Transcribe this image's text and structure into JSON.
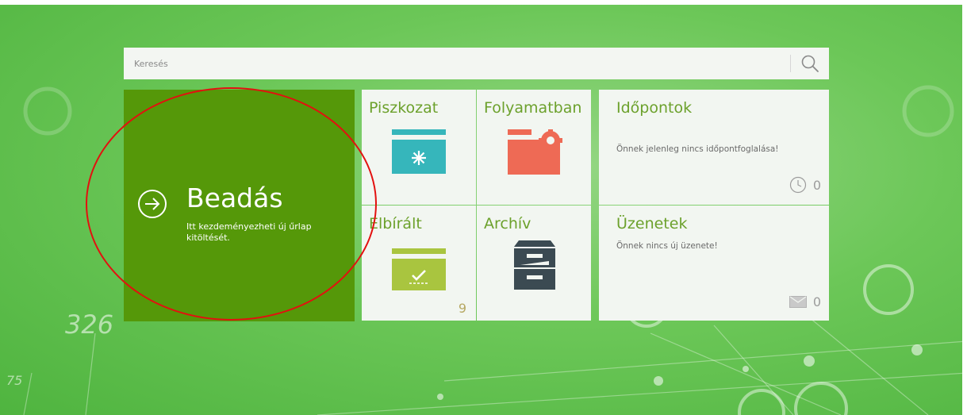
{
  "search": {
    "placeholder": "Keresés",
    "icon": "search-icon"
  },
  "background": {
    "numbers": [
      "326",
      "75"
    ]
  },
  "beadas": {
    "title": "Beadás",
    "description": "Itt kezdeményezheti új űrlap kitöltését.",
    "icon": "arrow-circle-right-icon",
    "color": "#559809"
  },
  "tiles": {
    "piszkozat": {
      "title": "Piszkozat",
      "icon": "folder-star-icon",
      "color": "#36b6bb"
    },
    "folyamatban": {
      "title": "Folyamatban",
      "icon": "folder-gear-icon",
      "color": "#ee6a55"
    },
    "elbiralt": {
      "title": "Elbírált",
      "icon": "folder-check-icon",
      "color": "#a9c53f",
      "count": "9"
    },
    "archiv": {
      "title": "Archív",
      "icon": "archive-cabinet-icon",
      "color": "#3b4a52"
    },
    "idopontok": {
      "title": "Időpontok",
      "message": "Önnek jelenleg nincs időpontfoglalása!",
      "icon": "clock-icon",
      "count": "0"
    },
    "uzenetek": {
      "title": "Üzenetek",
      "message": "Önnek nincs új üzenete!",
      "icon": "envelope-icon",
      "count": "0"
    }
  },
  "annotation_color": "#e3100f",
  "accent_green": "#6ca12c"
}
